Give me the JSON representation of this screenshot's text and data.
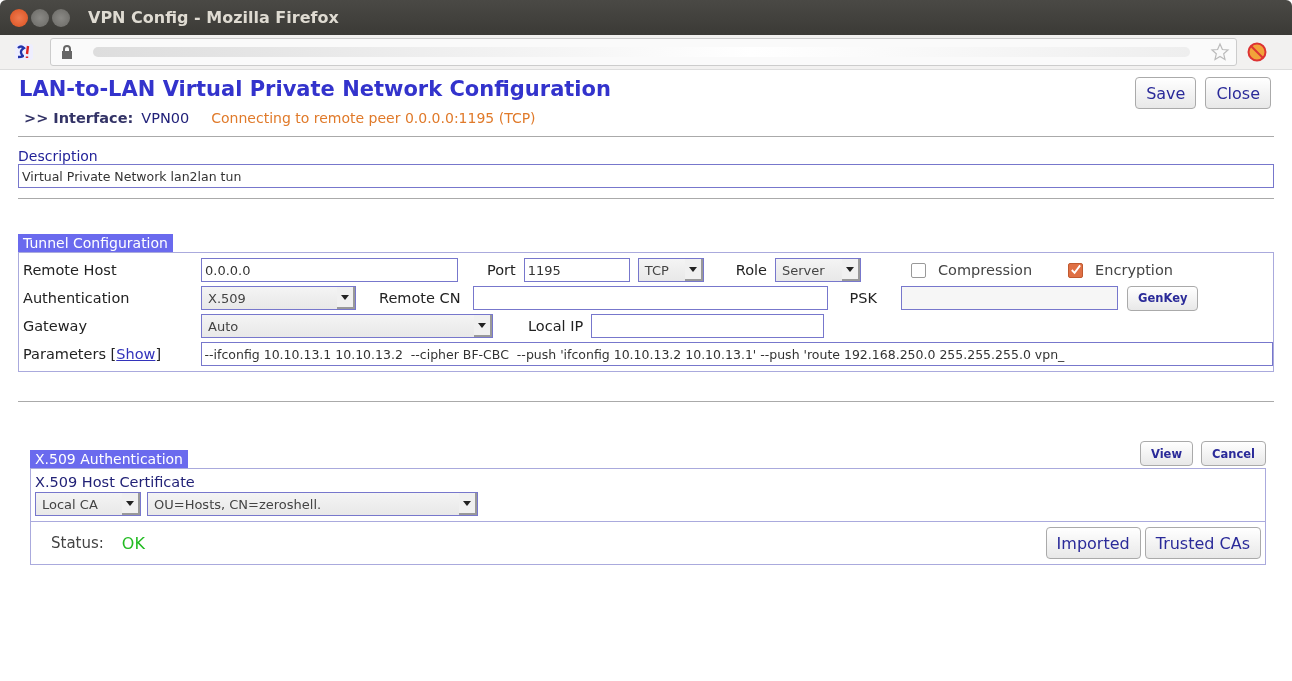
{
  "window": {
    "title": "VPN Config - Mozilla Firefox"
  },
  "page": {
    "heading": "LAN-to-LAN Virtual Private Network Configuration",
    "interface_label": ">> Interface:",
    "interface_value": "VPN00",
    "status_message": "Connecting to remote peer 0.0.0.0:1195 (TCP)",
    "buttons": [
      "Save",
      "Close"
    ]
  },
  "description": {
    "label": "Description",
    "value": "Virtual Private Network lan2lan tun"
  },
  "tunnel": {
    "title": "Tunnel Configuration",
    "remote_host": {
      "label": "Remote Host",
      "value": "0.0.0.0"
    },
    "port": {
      "label": "Port",
      "value": "1195"
    },
    "protocol": {
      "value": "TCP"
    },
    "role": {
      "label": "Role",
      "value": "Server"
    },
    "compression": {
      "label": "Compression",
      "checked": false
    },
    "encryption": {
      "label": "Encryption",
      "checked": true
    },
    "authentication": {
      "label": "Authentication",
      "value": "X.509"
    },
    "remote_cn": {
      "label": "Remote CN"
    },
    "psk": {
      "label": "PSK"
    },
    "genkey_button": "GenKey",
    "gateway": {
      "label": "Gateway",
      "value": "Auto"
    },
    "local_ip": {
      "label": "Local IP"
    },
    "parameters": {
      "label": "Parameters [",
      "link": "Show",
      "label_end": "]",
      "value": "--ifconfig 10.10.13.1 10.10.13.2  --cipher BF-CBC  --push 'ifconfig 10.10.13.2 10.10.13.1' --push 'route 192.168.250.0 255.255.255.0 vpn_"
    }
  },
  "x509": {
    "title": "X.509 Authentication",
    "buttons": [
      "View",
      "Cancel"
    ],
    "cert_label": "X.509 Host Certificate",
    "ca_value": "Local CA",
    "cert_value": "OU=Hosts, CN=zeroshell.",
    "status_label": "Status:",
    "status_value": "OK",
    "bottom_buttons": [
      "Imported",
      "Trusted CAs"
    ]
  }
}
